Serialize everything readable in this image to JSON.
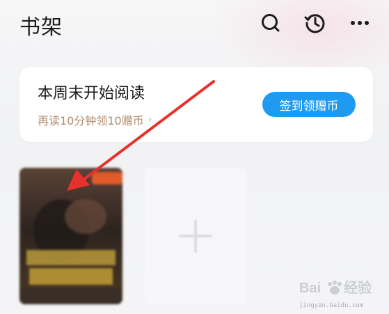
{
  "header": {
    "title": "书架",
    "icons": [
      "search-icon",
      "history-icon",
      "more-icon"
    ]
  },
  "reading_card": {
    "title": "本周末开始阅读",
    "subtitle": "再读10分钟领10赠币",
    "subtitle_chevron": "›",
    "button_label": "签到领赠币",
    "button_color": "#1e9bf0"
  },
  "shelf": {
    "books": [
      {
        "cover_colors": [
          "#3a2a26",
          "#7a5a3a",
          "#c9a43a",
          "#e05a2a"
        ]
      }
    ],
    "add_icon": "plus-icon"
  },
  "watermark": {
    "text": "jingyan.baidu.com"
  },
  "annotation": {
    "arrow_color": "#e5322d"
  }
}
